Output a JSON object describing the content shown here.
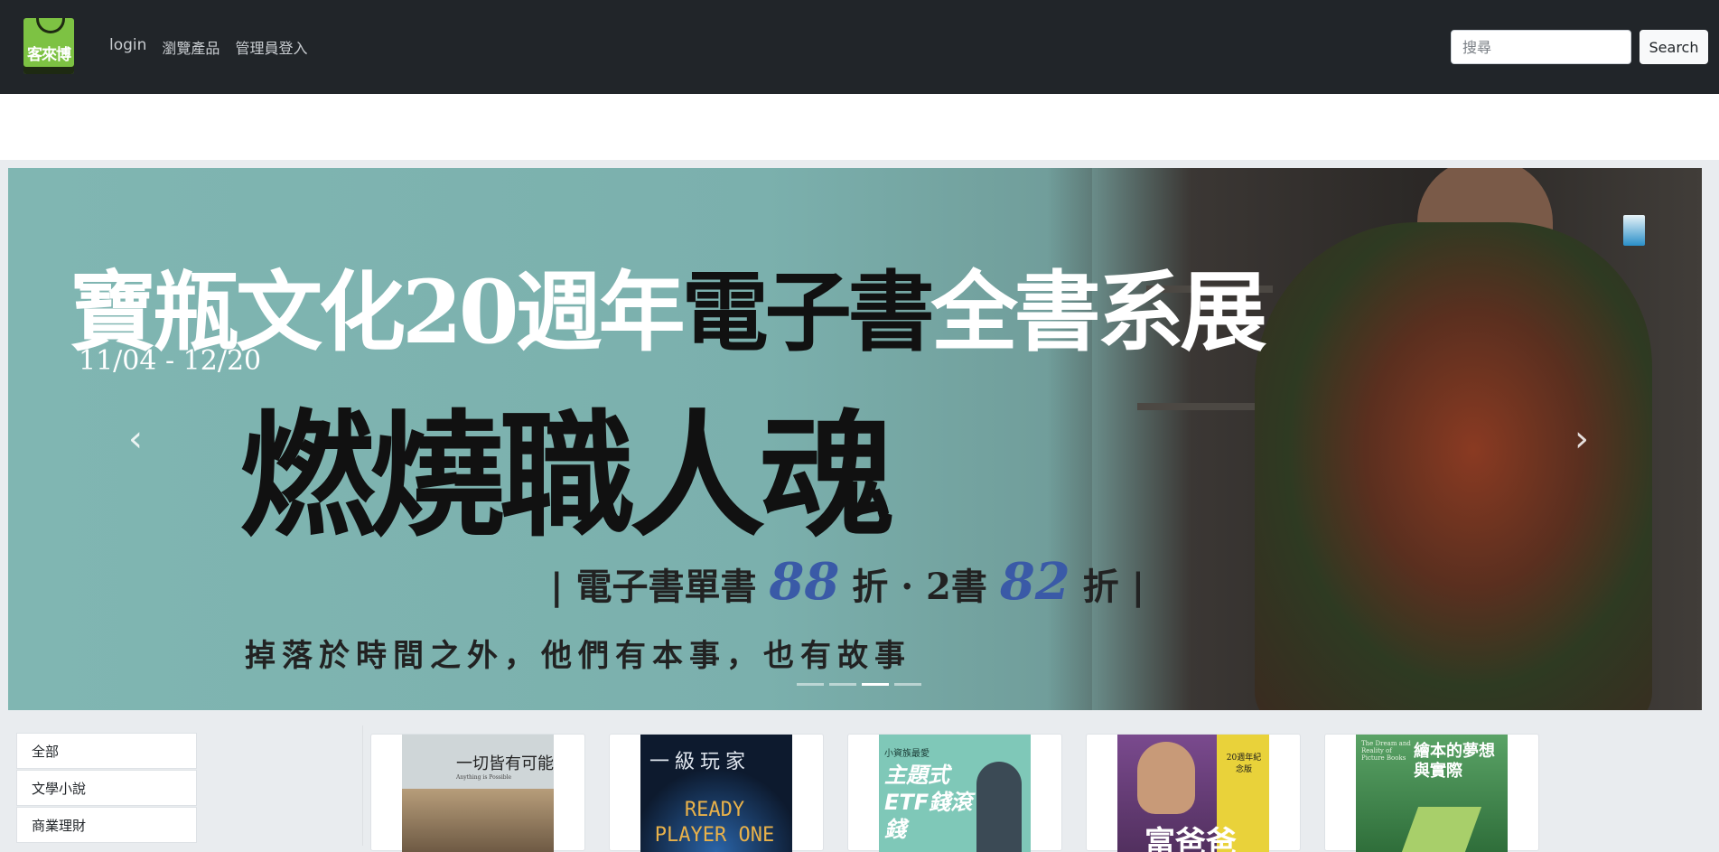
{
  "header": {
    "logo_text": "客來博",
    "nav": [
      {
        "label": "login"
      },
      {
        "label": "瀏覽產品"
      },
      {
        "label": "管理員登入"
      }
    ],
    "search": {
      "placeholder": "搜尋",
      "button_label": "Search"
    }
  },
  "carousel": {
    "slide": {
      "title_part1": "寶瓶文化20週年",
      "title_part2": "電子書",
      "title_part3": "全書系展",
      "date": "11/04 - 12/20",
      "headline": "燃燒職人魂",
      "sale_prefix": "| 電子書單書 ",
      "sale_num1": "88",
      "sale_mid": " 折 · 2書 ",
      "sale_num2": "82",
      "sale_suffix": " 折 |",
      "slogan": "掉落於時間之外，他們有本事，也有故事"
    },
    "prev_icon": "‹",
    "next_icon": "›",
    "indicator_count": 4,
    "active_indicator": 3
  },
  "categories": [
    "全部",
    "文學小說",
    "商業理財"
  ],
  "books": [
    {
      "cover_title": "一切皆有可能",
      "cover_sub": "Anything is Possible",
      "colors": {
        "bg": "#cfd6d8",
        "fg": "#222"
      }
    },
    {
      "cover_title": "一級玩家",
      "cover_sub": "READY PLAYER ONE",
      "colors": {
        "bg": "#0d1a2e",
        "fg": "#e8b14a"
      }
    },
    {
      "cover_title": "主題式ETF錢滾錢",
      "cover_sub": "小資族最愛",
      "colors": {
        "bg": "#7fc8b8",
        "fg": "#ffffff"
      }
    },
    {
      "cover_title": "富爸爸",
      "cover_sub": "20週年紀念版",
      "colors": {
        "bg": "#e9d23a",
        "fg": "#1a1a1a"
      }
    },
    {
      "cover_title": "繪本的夢想與實際",
      "cover_sub": "The Dream and Reality of Picture Books",
      "colors": {
        "bg": "#3f8a4a",
        "fg": "#ffffff"
      }
    }
  ]
}
